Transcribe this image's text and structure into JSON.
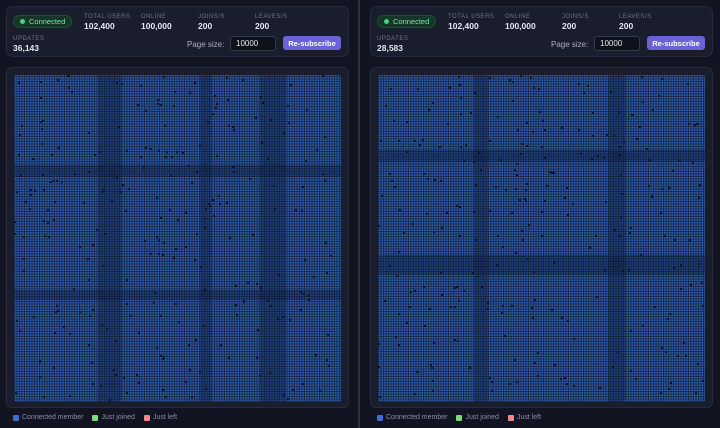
{
  "panels": [
    {
      "status": "Connected",
      "stats": {
        "total_users_label": "TOTAL USERS",
        "total_users": "102,400",
        "online_label": "ONLINE",
        "online": "100,000",
        "joins_label": "JOINS/S",
        "joins": "200",
        "leaves_label": "LEAVES/S",
        "leaves": "200"
      },
      "updates_label": "UPDATES",
      "updates": "36,143",
      "page_size_label": "Page size:",
      "page_size_value": "10000",
      "resubscribe_label": "Re-subscribe"
    },
    {
      "status": "Connected",
      "stats": {
        "total_users_label": "TOTAL USERS",
        "total_users": "102,400",
        "online_label": "ONLINE",
        "online": "100,000",
        "joins_label": "JOINS/S",
        "joins": "200",
        "leaves_label": "LEAVES/S",
        "leaves": "200"
      },
      "updates_label": "UPDATES",
      "updates": "28,583",
      "page_size_label": "Page size:",
      "page_size_value": "10000",
      "resubscribe_label": "Re-subscribe"
    }
  ],
  "legend": [
    {
      "label": "Connected member",
      "color": "#3d6fd0"
    },
    {
      "label": "Just joined",
      "color": "#7bdc7b"
    },
    {
      "label": "Just left",
      "color": "#f08a8a"
    }
  ],
  "colors": {
    "accent": "#6a62d8",
    "connected": "#46d37a",
    "cell": "#2f5aa3"
  }
}
